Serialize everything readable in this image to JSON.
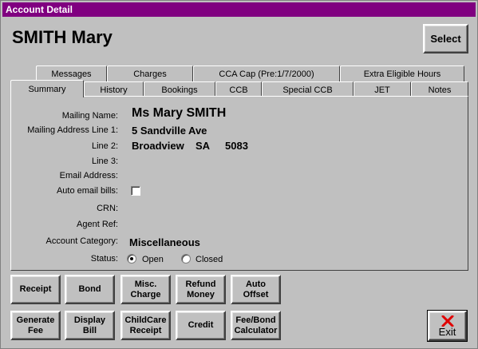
{
  "window": {
    "title": "Account Detail"
  },
  "account": {
    "name": "SMITH Mary"
  },
  "select_button": "Select",
  "tabs_back": [
    "Messages",
    "Charges",
    "CCA Cap (Pre:1/7/2000)",
    "Extra Eligible Hours"
  ],
  "tabs_front": [
    "Summary",
    "History",
    "Bookings",
    "CCB",
    "Special CCB",
    "JET",
    "Notes"
  ],
  "active_tab": "Summary",
  "fields": {
    "mailing_name_label": "Mailing Name:",
    "mailing_name": "Ms Mary SMITH",
    "address1_label": "Mailing Address Line 1:",
    "address1": "5 Sandville Ave",
    "line2_label": "Line 2:",
    "line2_suburb": "Broadview",
    "line2_state": "SA",
    "line2_postcode": "5083",
    "line3_label": "Line 3:",
    "email_label": "Email Address:",
    "auto_email_label": "Auto email bills:",
    "auto_email_checked": false,
    "crn_label": "CRN:",
    "agent_ref_label": "Agent Ref:",
    "category_label": "Account Category:",
    "category": "Miscellaneous",
    "status_label": "Status:",
    "status_open": "Open",
    "status_closed": "Closed",
    "status_selected": "Open"
  },
  "buttons": {
    "receipt": "Receipt",
    "bond": "Bond",
    "misc_charge_1": "Misc.",
    "misc_charge_2": "Charge",
    "refund_1": "Refund",
    "refund_2": "Money",
    "auto_offset_1": "Auto",
    "auto_offset_2": "Offset",
    "generate_fee_1": "Generate",
    "generate_fee_2": "Fee",
    "display_bill_1": "Display",
    "display_bill_2": "Bill",
    "childcare_receipt_1": "ChildCare",
    "childcare_receipt_2": "Receipt",
    "credit": "Credit",
    "fee_bond_1": "Fee/Bond",
    "fee_bond_2": "Calculator",
    "exit": "Exit"
  },
  "colors": {
    "titlebar": "#800080",
    "face": "#c0c0c0",
    "exit_x": "#e00000"
  }
}
